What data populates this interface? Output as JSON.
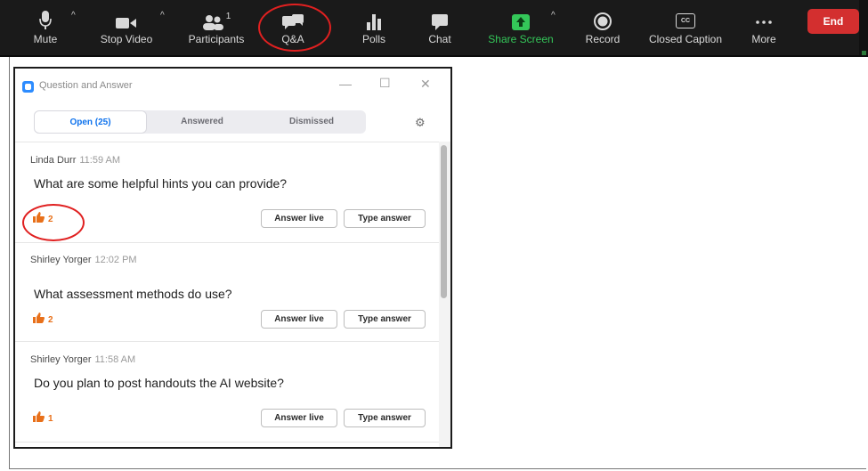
{
  "toolbar": {
    "items": [
      {
        "label": "Mute",
        "icon": "microphone-icon"
      },
      {
        "label": "Stop Video",
        "icon": "video-camera-icon"
      },
      {
        "label": "Participants",
        "icon": "participants-icon",
        "count": "1"
      },
      {
        "label": "Q&A",
        "icon": "qa-chat-icon"
      },
      {
        "label": "Polls",
        "icon": "polls-bar-icon"
      },
      {
        "label": "Chat",
        "icon": "chat-bubble-icon"
      },
      {
        "label": "Share Screen",
        "icon": "share-screen-arrow-icon"
      },
      {
        "label": "Record",
        "icon": "record-circle-icon"
      },
      {
        "label": "Closed Caption",
        "icon": "closed-caption-icon",
        "badge": "CC"
      },
      {
        "label": "More",
        "icon": "more-dots-icon"
      }
    ],
    "end_label": "End",
    "colors": {
      "background": "#1a1a1a",
      "end": "#d32f2f",
      "share": "#34c759",
      "highlight": "#e02020"
    }
  },
  "qa_window": {
    "title": "Question and Answer",
    "tabs": [
      {
        "label": "Open (25)",
        "active": true
      },
      {
        "label": "Answered",
        "active": false
      },
      {
        "label": "Dismissed",
        "active": false
      }
    ],
    "questions": [
      {
        "author": "Linda Durr",
        "time": "11:59 AM",
        "text": "What are some helpful hints you can provide?",
        "upvotes": "2"
      },
      {
        "author": "Shirley Yorger",
        "time": "12:02 PM",
        "text": "What assessment methods do use?",
        "upvotes": "2"
      },
      {
        "author": "Shirley Yorger",
        "time": "11:58 AM",
        "text": "Do you plan to post handouts the AI website?",
        "upvotes": "1"
      }
    ],
    "answer_live_label": "Answer live",
    "type_answer_label": "Type answer",
    "accent": "#0e72ed",
    "thumb_color": "#e8701a"
  }
}
